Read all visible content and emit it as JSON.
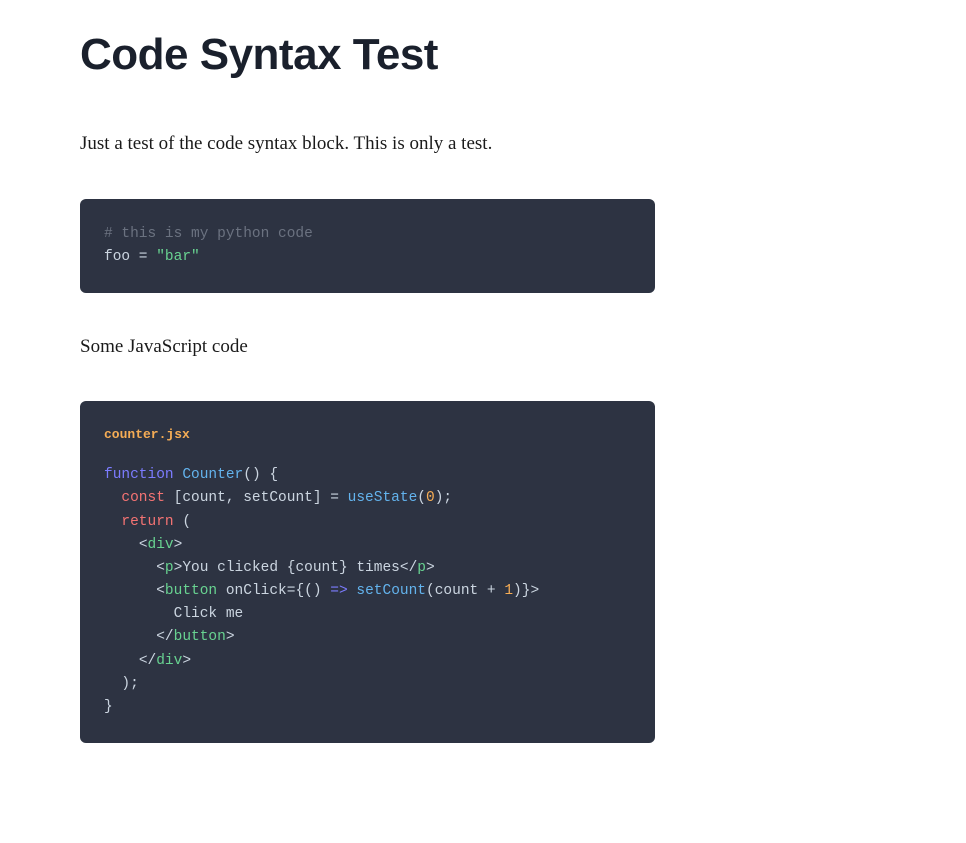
{
  "title": "Code Syntax Test",
  "intro": "Just a test of the code syntax block. This is only a test.",
  "block1": {
    "line1_comment": "# this is my python code",
    "line2_var": "foo",
    "line2_eq": " = ",
    "line2_str": "\"bar\""
  },
  "jsLabel": "Some JavaScript code",
  "block2": {
    "filename": "counter.jsx",
    "l1_kw": "function",
    "l1_sp": " ",
    "l1_name": "Counter",
    "l1_end": "() {",
    "l2_indent": "  ",
    "l2_kw": "const",
    "l2_mid": " [count, setCount] = ",
    "l2_fn": "useState",
    "l2_op": "(",
    "l2_num": "0",
    "l2_end": ");",
    "l3": "",
    "l4_indent": "  ",
    "l4_kw": "return",
    "l4_end": " (",
    "l5_indent": "    ",
    "l5_br1": "<",
    "l5_tag": "div",
    "l5_br2": ">",
    "l6_indent": "      ",
    "l6_br1": "<",
    "l6_tag1": "p",
    "l6_br2": ">",
    "l6_text": "You clicked {count} times",
    "l6_br3": "</",
    "l6_tag2": "p",
    "l6_br4": ">",
    "l7_indent": "      ",
    "l7_br1": "<",
    "l7_tag": "button",
    "l7_sp": " ",
    "l7_attr": "onClick",
    "l7_eq": "=",
    "l7_cb1": "{() ",
    "l7_arrow": "=>",
    "l7_sp2": " ",
    "l7_fn": "setCount",
    "l7_op1": "(count + ",
    "l7_num": "1",
    "l7_op2": ")}",
    "l7_br2": ">",
    "l8": "        Click me",
    "l9_indent": "      ",
    "l9_br1": "</",
    "l9_tag": "button",
    "l9_br2": ">",
    "l10_indent": "    ",
    "l10_br1": "</",
    "l10_tag": "div",
    "l10_br2": ">",
    "l11": "  );",
    "l12": "}"
  }
}
